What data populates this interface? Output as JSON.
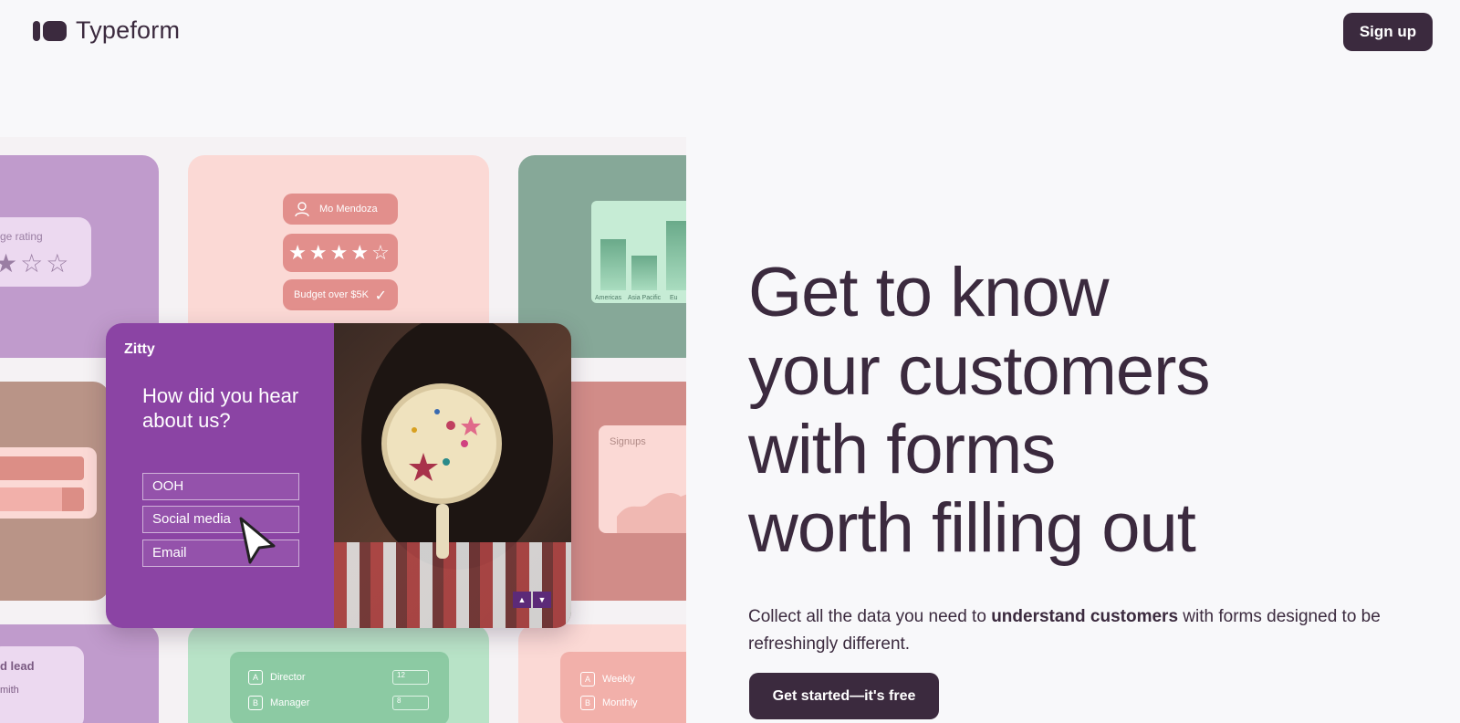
{
  "header": {
    "brand": "Typeform",
    "signup_label": "Sign up"
  },
  "hero": {
    "title_lines": [
      "Get to know",
      "your customers",
      "with forms",
      "worth filling out"
    ],
    "subtitle_prefix": "Collect all the data you need to ",
    "subtitle_bold": "understand customers",
    "subtitle_suffix": " with forms designed to be refreshingly different.",
    "cta_label": "Get started—it's free"
  },
  "collage": {
    "rating_label": "ge rating",
    "rating_stars": "★☆☆",
    "profile_name": "Mo Mendoza",
    "profile_stars": "★★★★☆",
    "budget_label": "Budget over $5K",
    "chart_labels": [
      "Americas",
      "Asia Pacific",
      "Eu"
    ],
    "signups_label": "Signups",
    "lead_title": "d lead",
    "lead_name": "mith",
    "options": [
      {
        "key": "A",
        "label": "Director",
        "value": "12"
      },
      {
        "key": "B",
        "label": "Manager",
        "value": "8"
      }
    ],
    "frequencies": [
      {
        "key": "A",
        "label": "Weekly"
      },
      {
        "key": "B",
        "label": "Monthly"
      }
    ],
    "form": {
      "brand": "Zitty",
      "question": "How did you hear about us?",
      "options": [
        "OOH",
        "Social media",
        "Email"
      ]
    }
  },
  "colors": {
    "primary": "#3b2a3e",
    "background": "#f8f8fa",
    "form_purple": "#8b44a4"
  }
}
